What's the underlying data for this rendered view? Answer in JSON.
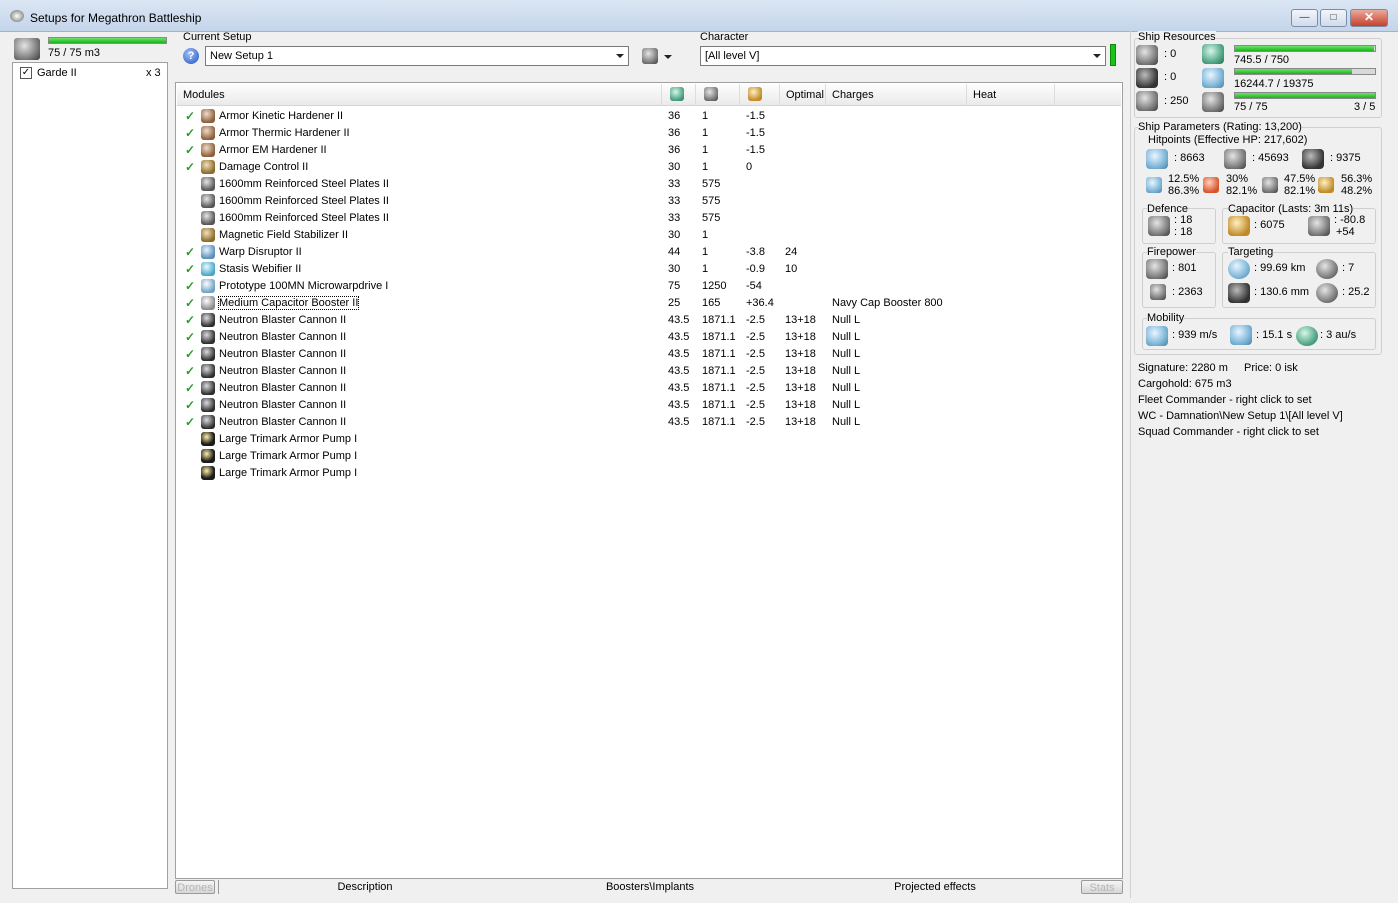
{
  "window": {
    "title": "Setups for Megathron Battleship",
    "btn_min": "—",
    "btn_max": "□",
    "btn_close": "✕"
  },
  "drones": {
    "bandwidth": "75 / 75 m3",
    "bandwidth_fraction": 1.0,
    "items": [
      {
        "name": "Garde II",
        "count": "x 3",
        "checked": true
      }
    ]
  },
  "setup": {
    "label": "Current Setup",
    "value": "New Setup 1"
  },
  "character": {
    "label": "Character",
    "value": "[All level V]"
  },
  "modules": {
    "headers": {
      "modules": "Modules",
      "optimal": "Optimal",
      "charges": "Charges",
      "heat": "Heat"
    },
    "rows": [
      {
        "name": "Armor Kinetic Hardener II",
        "cpu": "36",
        "pg": "1",
        "cap": "-1.5",
        "optimal": "",
        "charges": "",
        "active": true,
        "icon": "armor"
      },
      {
        "name": "Armor Thermic Hardener II",
        "cpu": "36",
        "pg": "1",
        "cap": "-1.5",
        "optimal": "",
        "charges": "",
        "active": true,
        "icon": "armor"
      },
      {
        "name": "Armor EM Hardener II",
        "cpu": "36",
        "pg": "1",
        "cap": "-1.5",
        "optimal": "",
        "charges": "",
        "active": true,
        "icon": "armor"
      },
      {
        "name": "Damage Control II",
        "cpu": "30",
        "pg": "1",
        "cap": "0",
        "optimal": "",
        "charges": "",
        "active": true,
        "icon": "mfs"
      },
      {
        "name": "1600mm Reinforced Steel Plates II",
        "cpu": "33",
        "pg": "575",
        "cap": "",
        "optimal": "",
        "charges": "",
        "active": false,
        "icon": "plate"
      },
      {
        "name": "1600mm Reinforced Steel Plates II",
        "cpu": "33",
        "pg": "575",
        "cap": "",
        "optimal": "",
        "charges": "",
        "active": false,
        "icon": "plate"
      },
      {
        "name": "1600mm Reinforced Steel Plates II",
        "cpu": "33",
        "pg": "575",
        "cap": "",
        "optimal": "",
        "charges": "",
        "active": false,
        "icon": "plate"
      },
      {
        "name": "Magnetic Field Stabilizer II",
        "cpu": "30",
        "pg": "1",
        "cap": "",
        "optimal": "",
        "charges": "",
        "active": false,
        "icon": "mfs"
      },
      {
        "name": "Warp Disruptor II",
        "cpu": "44",
        "pg": "1",
        "cap": "-3.8",
        "optimal": "24",
        "charges": "",
        "active": true,
        "icon": "warp"
      },
      {
        "name": "Stasis Webifier II",
        "cpu": "30",
        "pg": "1",
        "cap": "-0.9",
        "optimal": "10",
        "charges": "",
        "active": true,
        "icon": "web"
      },
      {
        "name": "Prototype 100MN Microwarpdrive I",
        "cpu": "75",
        "pg": "1250",
        "cap": "-54",
        "optimal": "",
        "charges": "",
        "active": true,
        "icon": "mwd"
      },
      {
        "name": "Medium Capacitor Booster II",
        "cpu": "25",
        "pg": "165",
        "cap": "+36.4",
        "optimal": "",
        "charges": "Navy Cap Booster 800",
        "active": true,
        "icon": "cap",
        "selected": true
      },
      {
        "name": "Neutron Blaster Cannon II",
        "cpu": "43.5",
        "pg": "1871.1",
        "cap": "-2.5",
        "optimal": "13+18",
        "charges": "Null L",
        "active": true,
        "icon": "gun"
      },
      {
        "name": "Neutron Blaster Cannon II",
        "cpu": "43.5",
        "pg": "1871.1",
        "cap": "-2.5",
        "optimal": "13+18",
        "charges": "Null L",
        "active": true,
        "icon": "gun"
      },
      {
        "name": "Neutron Blaster Cannon II",
        "cpu": "43.5",
        "pg": "1871.1",
        "cap": "-2.5",
        "optimal": "13+18",
        "charges": "Null L",
        "active": true,
        "icon": "gun"
      },
      {
        "name": "Neutron Blaster Cannon II",
        "cpu": "43.5",
        "pg": "1871.1",
        "cap": "-2.5",
        "optimal": "13+18",
        "charges": "Null L",
        "active": true,
        "icon": "gun"
      },
      {
        "name": "Neutron Blaster Cannon II",
        "cpu": "43.5",
        "pg": "1871.1",
        "cap": "-2.5",
        "optimal": "13+18",
        "charges": "Null L",
        "active": true,
        "icon": "gun"
      },
      {
        "name": "Neutron Blaster Cannon II",
        "cpu": "43.5",
        "pg": "1871.1",
        "cap": "-2.5",
        "optimal": "13+18",
        "charges": "Null L",
        "active": true,
        "icon": "gun"
      },
      {
        "name": "Neutron Blaster Cannon II",
        "cpu": "43.5",
        "pg": "1871.1",
        "cap": "-2.5",
        "optimal": "13+18",
        "charges": "Null L",
        "active": true,
        "icon": "gun"
      },
      {
        "name": "Large Trimark Armor Pump I",
        "cpu": "",
        "pg": "",
        "cap": "",
        "optimal": "",
        "charges": "",
        "active": false,
        "icon": "rig"
      },
      {
        "name": "Large Trimark Armor Pump I",
        "cpu": "",
        "pg": "",
        "cap": "",
        "optimal": "",
        "charges": "",
        "active": false,
        "icon": "rig"
      },
      {
        "name": "Large Trimark Armor Pump I",
        "cpu": "",
        "pg": "",
        "cap": "",
        "optimal": "",
        "charges": "",
        "active": false,
        "icon": "rig"
      }
    ]
  },
  "bottom_tabs": {
    "drones": "Drones",
    "description": "Description",
    "boosters": "Boosters\\Implants",
    "projected": "Projected effects",
    "stats": "Stats"
  },
  "resources": {
    "label": "Ship Resources",
    "turrets": ": 0",
    "launchers": ": 0",
    "calibration": ": 250",
    "cpu": "745.5 / 750",
    "cpu_fraction": 0.994,
    "powergrid": "16244.7 / 19375",
    "powergrid_fraction": 0.838,
    "drone_bw": "75 / 75",
    "drone_bw_fraction": 1.0,
    "drones_active": "3 / 5"
  },
  "params": {
    "label": "Ship Parameters (Rating: 13,200)",
    "hitpoints": "Hitpoints (Effective HP: 217,602)",
    "shield_hp": ": 8663",
    "armor_hp": ": 45693",
    "structure_hp": ": 9375",
    "res_em_a": "12.5%",
    "res_em_b": "86.3%",
    "res_th_a": "30%",
    "res_th_b": "82.1%",
    "res_ki_a": "47.5%",
    "res_ki_b": "82.1%",
    "res_ex_a": "56.3%",
    "res_ex_b": "48.2%",
    "defence_label": "Defence",
    "defence_a": ": 18",
    "defence_b": ": 18",
    "capacitor_label": "Capacitor (Lasts: 3m 11s)",
    "capacitor_value": ": 6075",
    "cap_a": ": -80.8",
    "cap_b": "+54",
    "firepower_label": "Firepower",
    "firepower_a": ": 801",
    "firepower_b": ": 2363",
    "targeting_label": "Targeting",
    "target_range": ": 99.69 km",
    "max_targets": ": 7",
    "scan_res": ": 130.6 mm",
    "sensor_str": ": 25.2",
    "mobility_label": "Mobility",
    "speed": ": 939 m/s",
    "align": ": 15.1 s",
    "warp": ": 3 au/s",
    "signature": "Signature: 2280 m",
    "price": "Price: 0 isk",
    "cargohold": "Cargohold: 675 m3",
    "fleet_commander": "Fleet Commander - right click to set",
    "wing_commander": "WC - Damnation\\New Setup 1\\[All level V]",
    "squad_commander": "Squad Commander - right click to set"
  },
  "colors": {
    "accent_green": "#18b518",
    "window_bg": "#f0f0f0",
    "check_green": "#2f9c2f"
  }
}
